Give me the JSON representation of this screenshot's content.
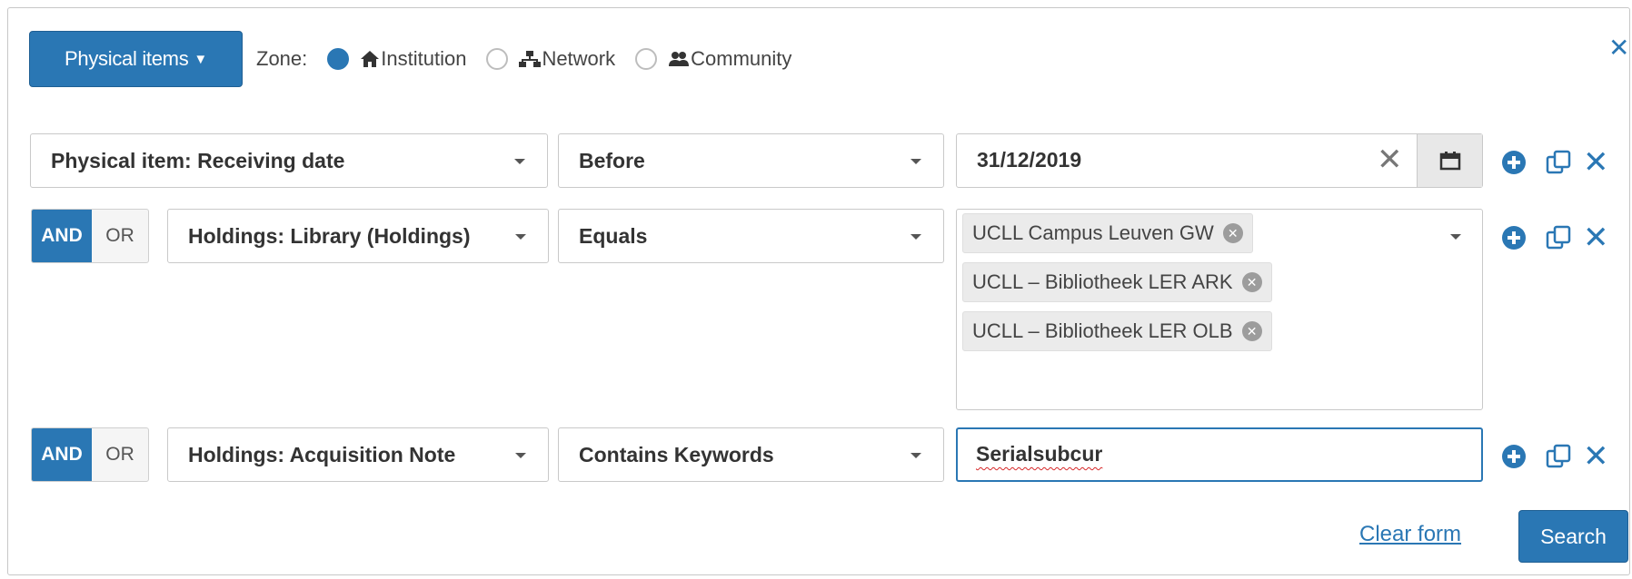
{
  "header": {
    "type_button_label": "Physical items",
    "zone_label": "Zone:",
    "zone_options": [
      {
        "label": "Institution",
        "icon": "home-icon",
        "selected": true
      },
      {
        "label": "Network",
        "icon": "network-icon",
        "selected": false
      },
      {
        "label": "Community",
        "icon": "community-icon",
        "selected": false
      }
    ],
    "close_symbol": "✕"
  },
  "rows": [
    {
      "operator": null,
      "field": "Physical item: Receiving date",
      "condition": "Before",
      "value": "31/12/2019"
    },
    {
      "operator": {
        "and": "AND",
        "or": "OR",
        "active": "AND"
      },
      "field": "Holdings: Library (Holdings)",
      "condition": "Equals",
      "chips": [
        "UCLL Campus Leuven GW",
        "UCLL – Bibliotheek LER ARK",
        "UCLL – Bibliotheek LER OLB"
      ]
    },
    {
      "operator": {
        "and": "AND",
        "or": "OR",
        "active": "AND"
      },
      "field": "Holdings: Acquisition Note",
      "condition": "Contains Keywords",
      "value": "Serialsubcur"
    }
  ],
  "footer": {
    "clear_label": "Clear form",
    "search_label": "Search"
  },
  "colors": {
    "accent": "#2a77b4",
    "border": "#c9c9c9"
  }
}
